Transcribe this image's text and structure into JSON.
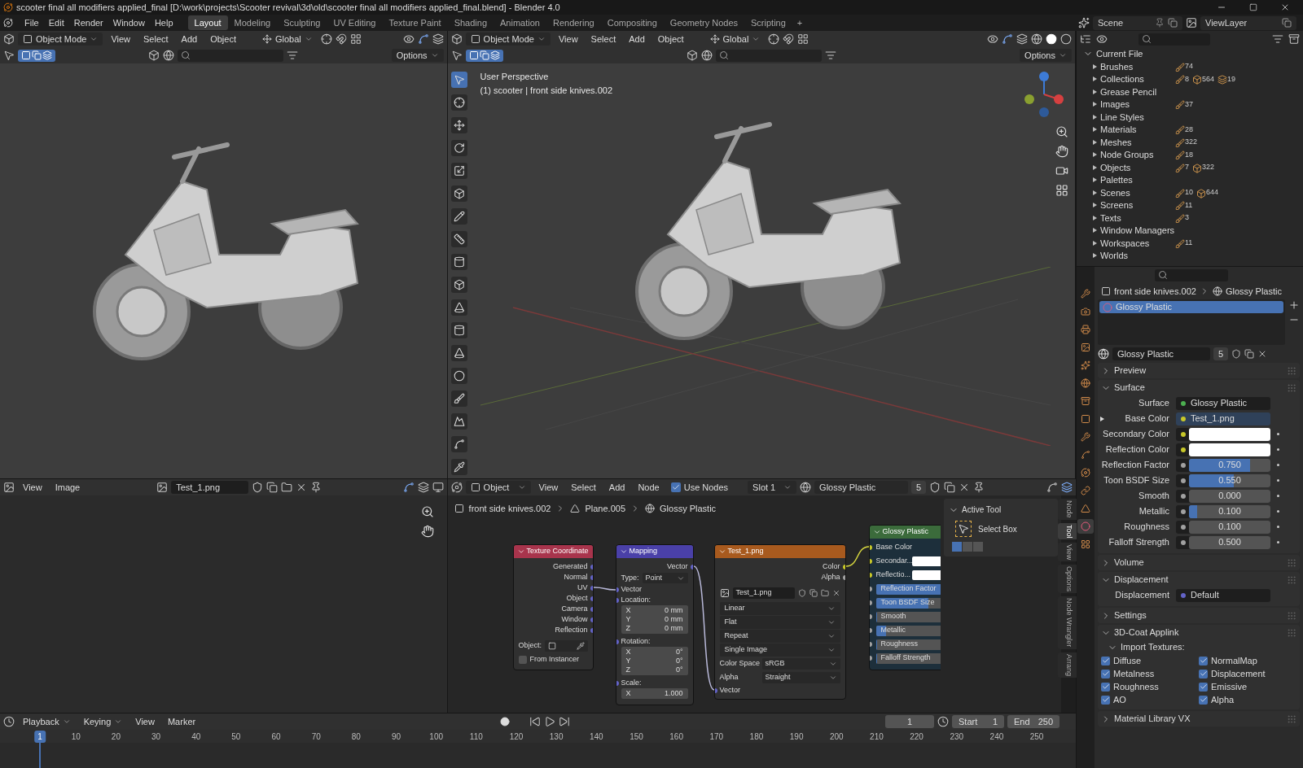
{
  "title_bar": {
    "title": "scooter final all modifiers applied_final [D:\\work\\projects\\Scooter revival\\3d\\old\\scooter final all modifiers applied_final.blend] - Blender 4.0"
  },
  "menu": [
    "File",
    "Edit",
    "Render",
    "Window",
    "Help"
  ],
  "workspaces": [
    {
      "label": "Layout",
      "selected": true
    },
    {
      "label": "Modeling",
      "selected": false
    },
    {
      "label": "Sculpting",
      "selected": false
    },
    {
      "label": "UV Editing",
      "selected": false
    },
    {
      "label": "Texture Paint",
      "selected": false
    },
    {
      "label": "Shading",
      "selected": false
    },
    {
      "label": "Animation",
      "selected": false
    },
    {
      "label": "Rendering",
      "selected": false
    },
    {
      "label": "Compositing",
      "selected": false
    },
    {
      "label": "Geometry Nodes",
      "selected": false
    },
    {
      "label": "Scripting",
      "selected": false
    }
  ],
  "add_workspace": "+",
  "scene": {
    "scene": "Scene",
    "view_layer": "ViewLayer"
  },
  "viewports": [
    {
      "mode": "Object Mode",
      "menus": [
        "View",
        "Select",
        "Add",
        "Object"
      ],
      "orientation": "Global",
      "options": "Options"
    },
    {
      "mode": "Object Mode",
      "menus": [
        "View",
        "Select",
        "Add",
        "Object"
      ],
      "orientation": "Global",
      "options": "Options",
      "overlay": [
        "User Perspective",
        "(1) scooter | front side knives.002"
      ]
    }
  ],
  "image_editor": {
    "menus": [
      "View",
      "Image"
    ],
    "image": "Test_1.png"
  },
  "node_editor": {
    "mode": "Object",
    "menus": [
      "View",
      "Select",
      "Add",
      "Node"
    ],
    "use_nodes": {
      "label": "Use Nodes",
      "checked": true
    },
    "slot": "Slot 1",
    "material": "Glossy Plastic",
    "users": "5",
    "breadcrumbs": [
      "front side knives.002",
      "Plane.005",
      "Glossy Plastic"
    ],
    "nodes": [
      {
        "kind": "texture_coordinate",
        "title": "Texture Coordinate",
        "color": "#a8344c",
        "outputs": [
          "Generated",
          "Normal",
          "UV",
          "Object",
          "Camera",
          "Window",
          "Reflection"
        ],
        "object_label": "Object:",
        "from_instancer": {
          "label": "From Instancer",
          "checked": false
        }
      },
      {
        "kind": "mapping",
        "title": "Mapping",
        "color": "#4a40a8",
        "output": "Vector",
        "type_label": "Type:",
        "type": "Point",
        "input": "Vector",
        "groups": [
          {
            "label": "Location:",
            "rows": [
              {
                "axis": "X",
                "value": "0 mm"
              },
              {
                "axis": "Y",
                "value": "0 mm"
              },
              {
                "axis": "Z",
                "value": "0 mm"
              }
            ]
          },
          {
            "label": "Rotation:",
            "rows": [
              {
                "axis": "X",
                "value": "0°"
              },
              {
                "axis": "Y",
                "value": "0°"
              },
              {
                "axis": "Z",
                "value": "0°"
              }
            ]
          },
          {
            "label": "Scale:",
            "rows": [
              {
                "axis": "X",
                "value": "1.000"
              }
            ]
          }
        ]
      },
      {
        "kind": "image_texture",
        "title": "Test_1.png",
        "color": "#a85a1e",
        "outputs": [
          "Color",
          "Alpha"
        ],
        "image": "Test_1.png",
        "dropdowns": [
          "Linear",
          "Flat",
          "Repeat",
          "Single Image"
        ],
        "fields": [
          {
            "label": "Color Space",
            "value": "sRGB"
          },
          {
            "label": "Alpha",
            "value": "Straight"
          }
        ],
        "input": "Vector"
      },
      {
        "kind": "group",
        "title": "Glossy Plastic",
        "color": "#3b6b3b",
        "inputs": [
          {
            "kind": "linked",
            "label": "Base Color",
            "color": "#c7c729"
          },
          {
            "kind": "color",
            "label": "Secondar...",
            "color": "#c7c729"
          },
          {
            "kind": "color",
            "label": "Reflectio...",
            "color": "#c7c729"
          },
          {
            "kind": "slider",
            "label": "Reflection Factor",
            "color": "#a1a1a1",
            "level": 0.75
          },
          {
            "kind": "slider",
            "label": "Toon BSDF Size",
            "color": "#a1a1a1",
            "level": 0.55
          },
          {
            "kind": "slider",
            "label": "Smooth",
            "color": "#a1a1a1",
            "level": 0
          },
          {
            "kind": "slider",
            "label": "Metallic",
            "color": "#a1a1a1",
            "level": 0.1
          },
          {
            "kind": "slider",
            "label": "Roughness",
            "color": "#a1a1a1",
            "level": 0
          },
          {
            "kind": "slider",
            "label": "Falloff Strength",
            "color": "#a1a1a1",
            "level": 0
          }
        ]
      }
    ],
    "sidebar": {
      "tabs": [
        {
          "label": "Node",
          "selected": false
        },
        {
          "label": "Tool",
          "selected": true
        },
        {
          "label": "View",
          "selected": false
        },
        {
          "label": "Options",
          "selected": false
        },
        {
          "label": "Node Wrangler",
          "selected": false
        },
        {
          "label": "Arrang",
          "selected": false
        }
      ],
      "panel_title": "Active Tool",
      "tool": "Select Box"
    }
  },
  "timeline": {
    "menus": [
      "Playback",
      "Keying",
      "View",
      "Marker"
    ],
    "current_frame": "1",
    "start_label": "Start",
    "start": "1",
    "end_label": "End",
    "end": "250",
    "ruler": [
      {
        "label": "1",
        "selected": true
      },
      {
        "label": "10",
        "selected": false
      },
      {
        "label": "20",
        "selected": false
      },
      {
        "label": "30",
        "selected": false
      },
      {
        "label": "40",
        "selected": false
      },
      {
        "label": "50",
        "selected": false
      },
      {
        "label": "60",
        "selected": false
      },
      {
        "label": "70",
        "selected": false
      },
      {
        "label": "80",
        "selected": false
      },
      {
        "label": "90",
        "selected": false
      },
      {
        "label": "100",
        "selected": false
      },
      {
        "label": "110",
        "selected": false
      },
      {
        "label": "120",
        "selected": false
      },
      {
        "label": "130",
        "selected": false
      },
      {
        "label": "140",
        "selected": false
      },
      {
        "label": "150",
        "selected": false
      },
      {
        "label": "160",
        "selected": false
      },
      {
        "label": "170",
        "selected": false
      },
      {
        "label": "180",
        "selected": false
      },
      {
        "label": "190",
        "selected": false
      },
      {
        "label": "200",
        "selected": false
      },
      {
        "label": "210",
        "selected": false
      },
      {
        "label": "220",
        "selected": false
      },
      {
        "label": "230",
        "selected": false
      },
      {
        "label": "240",
        "selected": false
      },
      {
        "label": "250",
        "selected": false
      }
    ]
  },
  "outliner": {
    "root": "Current File",
    "expanded": true,
    "items": [
      {
        "label": "Brushes",
        "expanded": false,
        "counts": [
          "74"
        ]
      },
      {
        "label": "Collections",
        "expanded": false,
        "counts": [
          "8",
          "564",
          "19"
        ]
      },
      {
        "label": "Grease Pencil",
        "expanded": false
      },
      {
        "label": "Images",
        "expanded": false,
        "counts": [
          "37"
        ]
      },
      {
        "label": "Line Styles",
        "expanded": false
      },
      {
        "label": "Materials",
        "expanded": false,
        "counts": [
          "28"
        ]
      },
      {
        "label": "Meshes",
        "expanded": false,
        "counts": [
          "322"
        ]
      },
      {
        "label": "Node Groups",
        "expanded": false,
        "counts": [
          "18"
        ]
      },
      {
        "label": "Objects",
        "expanded": false,
        "counts": [
          "7",
          "322"
        ]
      },
      {
        "label": "Palettes",
        "expanded": false
      },
      {
        "label": "Scenes",
        "expanded": false,
        "counts": [
          "10",
          "644"
        ]
      },
      {
        "label": "Screens",
        "expanded": false,
        "counts": [
          "11"
        ]
      },
      {
        "label": "Texts",
        "expanded": false,
        "counts": [
          "3"
        ]
      },
      {
        "label": "Window Managers",
        "expanded": false
      },
      {
        "label": "Workspaces",
        "expanded": false,
        "counts": [
          "11"
        ]
      },
      {
        "label": "Worlds",
        "expanded": false
      }
    ]
  },
  "properties": {
    "tabs": [
      {
        "kind": "tool",
        "selected": false
      },
      {
        "kind": "render",
        "selected": false
      },
      {
        "kind": "output",
        "selected": false
      },
      {
        "kind": "view_layer",
        "selected": false
      },
      {
        "kind": "scene",
        "selected": false
      },
      {
        "kind": "world",
        "selected": false
      },
      {
        "kind": "collection",
        "selected": false
      },
      {
        "kind": "object",
        "selected": false
      },
      {
        "kind": "modifiers",
        "selected": false
      },
      {
        "kind": "particles",
        "selected": false
      },
      {
        "kind": "physics",
        "selected": false
      },
      {
        "kind": "constraints",
        "selected": false
      },
      {
        "kind": "data",
        "selected": false
      },
      {
        "kind": "material",
        "selected": true
      },
      {
        "kind": "texture",
        "selected": false
      }
    ],
    "breadcrumbs": [
      "front side knives.002",
      "Glossy Plastic"
    ],
    "slots": [
      {
        "label": "Glossy Plastic",
        "selected": true
      }
    ],
    "material": {
      "name": "Glossy Plastic",
      "users": "5"
    },
    "sections": [
      {
        "title": "Preview",
        "expanded": false
      },
      {
        "title": "Surface",
        "expanded": true,
        "rows": [
          {
            "kind": "socket",
            "label": "Surface",
            "value": "Glossy Plastic",
            "color": "#4caf50"
          },
          {
            "kind": "linked",
            "label": "Base Color",
            "value": "Test_1.png",
            "color": "#c7c729",
            "expanded": false
          },
          {
            "kind": "color",
            "label": "Secondary Color",
            "color": "#c7c729"
          },
          {
            "kind": "color",
            "label": "Reflection Color",
            "color": "#c7c729"
          },
          {
            "kind": "slider",
            "label": "Reflection Factor",
            "value": "0.750",
            "level": 0.75,
            "color": "#a1a1a1"
          },
          {
            "kind": "slider",
            "label": "Toon BSDF Size",
            "value": "0.550",
            "level": 0.55,
            "color": "#a1a1a1"
          },
          {
            "kind": "slider",
            "label": "Smooth",
            "value": "0.000",
            "level": 0,
            "color": "#a1a1a1"
          },
          {
            "kind": "slider",
            "label": "Metallic",
            "value": "0.100",
            "level": 0.1,
            "color": "#a1a1a1"
          },
          {
            "kind": "slider",
            "label": "Roughness",
            "value": "0.100",
            "level": 0,
            "color": "#a1a1a1"
          },
          {
            "kind": "slider",
            "label": "Falloff Strength",
            "value": "0.500",
            "level": 0,
            "color": "#a1a1a1"
          }
        ]
      },
      {
        "title": "Volume",
        "expanded": false
      },
      {
        "title": "Displacement",
        "expanded": true,
        "rows": [
          {
            "kind": "socket",
            "label": "Displacement",
            "value": "Default",
            "color": "#6363c7"
          }
        ]
      },
      {
        "title": "Settings",
        "expanded": false
      },
      {
        "title": "3D-Coat Applink",
        "expanded": true,
        "subsection": {
          "title": "Import Textures:",
          "expanded": true
        },
        "checkboxes": [
          {
            "label": "Diffuse",
            "checked": true
          },
          {
            "label": "NormalMap",
            "checked": true
          },
          {
            "label": "Metalness",
            "checked": true
          },
          {
            "label": "Displacement",
            "checked": true
          },
          {
            "label": "Roughness",
            "checked": true
          },
          {
            "label": "Emissive",
            "checked": true
          },
          {
            "label": "AO",
            "checked": true
          },
          {
            "label": "Alpha",
            "checked": true
          }
        ]
      },
      {
        "title": "Material Library VX",
        "expanded": false
      }
    ]
  }
}
